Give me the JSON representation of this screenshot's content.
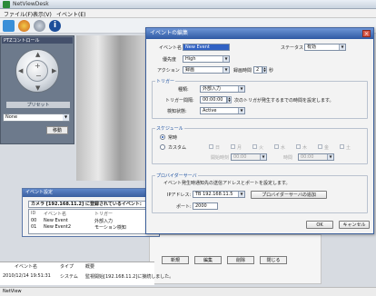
{
  "app": {
    "title": "NetViewDesk",
    "menu": [
      "ファイル(F)",
      "表示(V)",
      "イベント(E)"
    ],
    "statusbar": "NetView"
  },
  "ptz": {
    "header": "PTZコントロール",
    "label": "プリセット",
    "preset_value": "None",
    "move_button": "移動"
  },
  "event_list": {
    "title": "イベント設定",
    "camera_header": "カメラ [192.168.11.2] に登録されているイベント:",
    "columns": [
      "ID",
      "イベント名",
      "トリガー"
    ],
    "rows": [
      {
        "id": "00",
        "name": "New Event",
        "trigger": "外部入力"
      },
      {
        "id": "01",
        "name": "New Event2",
        "trigger": "モーション検知"
      }
    ]
  },
  "bottom_buttons": [
    "新規",
    "編集",
    "削除",
    "閉じる"
  ],
  "log": {
    "columns": [
      "",
      "イベント名",
      "タイプ",
      "概要"
    ],
    "rows": [
      {
        "time": "2010/12/14 19:51:31",
        "type": "システム",
        "desc": "監視開始[192.168.11.2]に接続しました。"
      }
    ]
  },
  "edit_dialog": {
    "title": "イベントの編集",
    "close": "×",
    "event_name_label": "イベント名",
    "event_name_value": "New Event",
    "status_label": "ステータス",
    "status_value": "有効",
    "priority_label": "優先度",
    "priority_value": "High",
    "action_label": "アクション",
    "action_value": "録画",
    "duration_label": "録画時間",
    "duration_value": "2",
    "duration_unit": "秒",
    "trigger_group": "トリガー",
    "type_label": "種類:",
    "type_value": "外部入力",
    "interval_label": "トリガー間隔:",
    "interval_value": "00:00:00",
    "interval_note": "次のトリガが発生するまでの時間を設定します。",
    "detect_label": "検知状態:",
    "detect_value": "Active",
    "schedule_group": "スケジュール",
    "radio_always": "常時",
    "radio_custom": "カスタム",
    "days": [
      "日",
      "月",
      "火",
      "水",
      "木",
      "金",
      "土"
    ],
    "start_time_label": "開始時刻",
    "start_time_value": "00:00",
    "end_time_label": "時間",
    "end_time_value": "00:00",
    "server_group": "プロバイダーサーバ",
    "server_note": "イベント発生時通知先の送信アドレスとポートを設定します。",
    "ip_label": "IPアドレス:",
    "ip_value": "TB 192.168.11.5",
    "add_server_button": "プロバイダーサーバの追加",
    "port_label": "ポート:",
    "port_value": "2000",
    "ok": "OK",
    "cancel": "キャンセル"
  },
  "colors": {
    "dialog_title": "#2f5aa3",
    "selection": "#3162c4"
  }
}
